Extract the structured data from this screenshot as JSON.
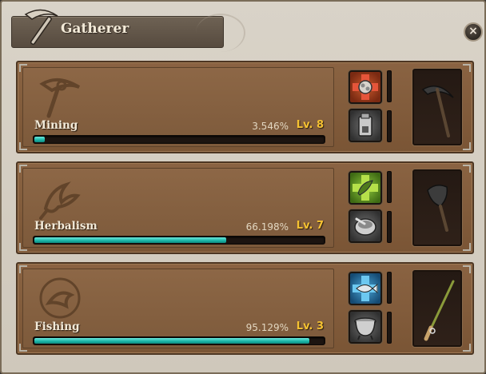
{
  "window": {
    "title": "Gatherer",
    "title_icon": "pickaxe-icon",
    "close_icon": "close-icon",
    "close_label": "×"
  },
  "skills": [
    {
      "name": "Mining",
      "percent": "3.546%",
      "level": "Lv. 8",
      "progress": 0.035,
      "emblem": "pickaxe-emblem-icon",
      "slot_top": "ore-refine-icon",
      "slot_bottom": "smelter-icon",
      "tool": "pickaxe-tool-icon"
    },
    {
      "name": "Herbalism",
      "percent": "66.198%",
      "level": "Lv. 7",
      "progress": 0.662,
      "emblem": "herb-emblem-icon",
      "slot_top": "herb-refine-icon",
      "slot_bottom": "mortar-icon",
      "tool": "trowel-tool-icon"
    },
    {
      "name": "Fishing",
      "percent": "95.129%",
      "level": "Lv. 3",
      "progress": 0.951,
      "emblem": "fish-emblem-icon",
      "slot_top": "fish-refine-icon",
      "slot_bottom": "cooking-pot-icon",
      "tool": "fishing-rod-tool-icon"
    }
  ],
  "colors": {
    "level_text": "#f6c232",
    "progress_fill": "#19b3a6",
    "panel_wood": "#8a6342"
  }
}
